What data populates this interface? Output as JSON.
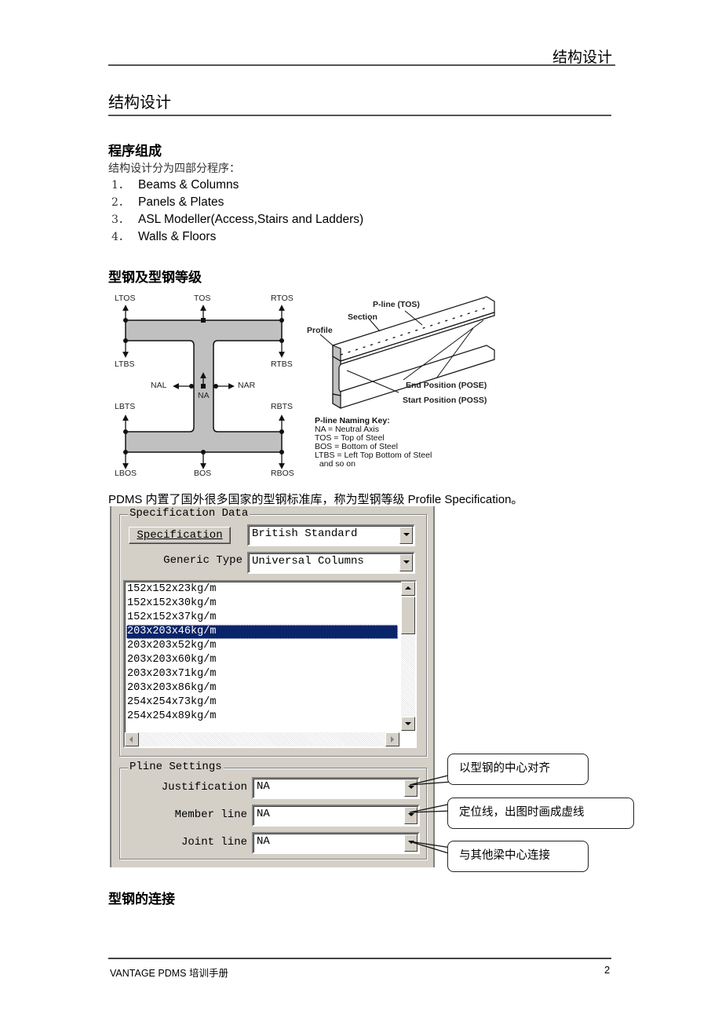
{
  "header": {
    "running_title": "结构设计"
  },
  "page_title": "结构设计",
  "sections": {
    "program": {
      "heading": "程序组成",
      "intro": "结构设计分为四部分程序：",
      "items": [
        {
          "num": "1．",
          "label": "Beams & Columns"
        },
        {
          "num": "2．",
          "label": "Panels & Plates"
        },
        {
          "num": "3．",
          "label": "ASL Modeller(Access,Stairs and Ladders)"
        },
        {
          "num": "4．",
          "label": "Walls & Floors"
        }
      ]
    },
    "profiles": {
      "heading": "型钢及型钢等级",
      "section_labels": {
        "ltos": "LTOS",
        "tos": "TOS",
        "rtos": "RTOS",
        "ltbs": "LTBS",
        "rtbs": "RTBS",
        "nal": "NAL",
        "na": "NA",
        "nar": "NAR",
        "lbts": "LBTS",
        "rbts": "RBTS",
        "lbos": "LBOS",
        "bos": "BOS",
        "rbos": "RBOS"
      },
      "iso_labels": {
        "pline": "P-line (TOS)",
        "section": "Section",
        "profile": "Profile",
        "end": "End Position (POSE)",
        "start": "Start Position (POSS)"
      },
      "key": {
        "title": "P-line Naming Key:",
        "lines": [
          "NA = Neutral Axis",
          "TOS = Top of Steel",
          "BOS = Bottom of Steel",
          "LTBS = Left Top Bottom of Steel",
          "  and so on"
        ]
      },
      "description": "PDMS 内置了国外很多国家的型钢标准库，称为型钢等级 Profile Specification。"
    },
    "connection": {
      "heading": "型钢的连接"
    }
  },
  "dialog": {
    "spec_group_title": "Specification Data",
    "spec_button": "Specification",
    "spec_value": "British Standard",
    "generic_type_label": "Generic Type",
    "generic_type_value": "Universal Columns",
    "profiles": [
      "152x152x23kg/m",
      "152x152x30kg/m",
      "152x152x37kg/m",
      "203x203x46kg/m",
      "203x203x52kg/m",
      "203x203x60kg/m",
      "203x203x71kg/m",
      "203x203x86kg/m",
      "254x254x73kg/m",
      "254x254x89kg/m"
    ],
    "selected_index": 3,
    "pline_group_title": "Pline Settings",
    "justification_label": "Justification",
    "justification_value": "NA",
    "member_line_label": "Member line",
    "member_line_value": "NA",
    "joint_line_label": "Joint line",
    "joint_line_value": "NA",
    "selection_color": "#0a246a"
  },
  "callouts": {
    "justification": "以型钢的中心对齐",
    "member_line": "定位线，出图时画成虚线",
    "joint_line": "与其他梁中心连接"
  },
  "footer": {
    "left": "VANTAGE PDMS 培训手册",
    "page_number": "2"
  }
}
